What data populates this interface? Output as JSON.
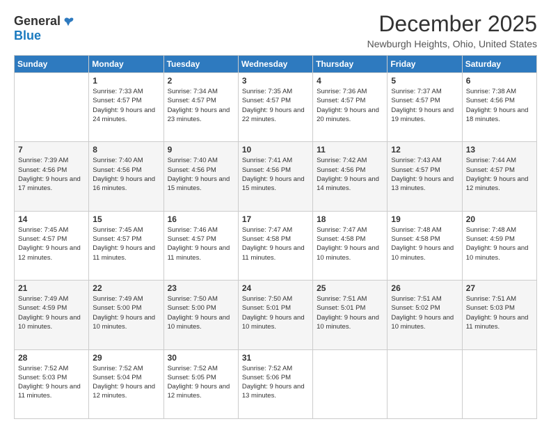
{
  "logo": {
    "general": "General",
    "blue": "Blue"
  },
  "header": {
    "month_year": "December 2025",
    "location": "Newburgh Heights, Ohio, United States"
  },
  "days_of_week": [
    "Sunday",
    "Monday",
    "Tuesday",
    "Wednesday",
    "Thursday",
    "Friday",
    "Saturday"
  ],
  "weeks": [
    [
      {
        "num": "",
        "sunrise": "",
        "sunset": "",
        "daylight": "",
        "empty": true
      },
      {
        "num": "1",
        "sunrise": "Sunrise: 7:33 AM",
        "sunset": "Sunset: 4:57 PM",
        "daylight": "Daylight: 9 hours and 24 minutes."
      },
      {
        "num": "2",
        "sunrise": "Sunrise: 7:34 AM",
        "sunset": "Sunset: 4:57 PM",
        "daylight": "Daylight: 9 hours and 23 minutes."
      },
      {
        "num": "3",
        "sunrise": "Sunrise: 7:35 AM",
        "sunset": "Sunset: 4:57 PM",
        "daylight": "Daylight: 9 hours and 22 minutes."
      },
      {
        "num": "4",
        "sunrise": "Sunrise: 7:36 AM",
        "sunset": "Sunset: 4:57 PM",
        "daylight": "Daylight: 9 hours and 20 minutes."
      },
      {
        "num": "5",
        "sunrise": "Sunrise: 7:37 AM",
        "sunset": "Sunset: 4:57 PM",
        "daylight": "Daylight: 9 hours and 19 minutes."
      },
      {
        "num": "6",
        "sunrise": "Sunrise: 7:38 AM",
        "sunset": "Sunset: 4:56 PM",
        "daylight": "Daylight: 9 hours and 18 minutes."
      }
    ],
    [
      {
        "num": "7",
        "sunrise": "Sunrise: 7:39 AM",
        "sunset": "Sunset: 4:56 PM",
        "daylight": "Daylight: 9 hours and 17 minutes."
      },
      {
        "num": "8",
        "sunrise": "Sunrise: 7:40 AM",
        "sunset": "Sunset: 4:56 PM",
        "daylight": "Daylight: 9 hours and 16 minutes."
      },
      {
        "num": "9",
        "sunrise": "Sunrise: 7:40 AM",
        "sunset": "Sunset: 4:56 PM",
        "daylight": "Daylight: 9 hours and 15 minutes."
      },
      {
        "num": "10",
        "sunrise": "Sunrise: 7:41 AM",
        "sunset": "Sunset: 4:56 PM",
        "daylight": "Daylight: 9 hours and 15 minutes."
      },
      {
        "num": "11",
        "sunrise": "Sunrise: 7:42 AM",
        "sunset": "Sunset: 4:56 PM",
        "daylight": "Daylight: 9 hours and 14 minutes."
      },
      {
        "num": "12",
        "sunrise": "Sunrise: 7:43 AM",
        "sunset": "Sunset: 4:57 PM",
        "daylight": "Daylight: 9 hours and 13 minutes."
      },
      {
        "num": "13",
        "sunrise": "Sunrise: 7:44 AM",
        "sunset": "Sunset: 4:57 PM",
        "daylight": "Daylight: 9 hours and 12 minutes."
      }
    ],
    [
      {
        "num": "14",
        "sunrise": "Sunrise: 7:45 AM",
        "sunset": "Sunset: 4:57 PM",
        "daylight": "Daylight: 9 hours and 12 minutes."
      },
      {
        "num": "15",
        "sunrise": "Sunrise: 7:45 AM",
        "sunset": "Sunset: 4:57 PM",
        "daylight": "Daylight: 9 hours and 11 minutes."
      },
      {
        "num": "16",
        "sunrise": "Sunrise: 7:46 AM",
        "sunset": "Sunset: 4:57 PM",
        "daylight": "Daylight: 9 hours and 11 minutes."
      },
      {
        "num": "17",
        "sunrise": "Sunrise: 7:47 AM",
        "sunset": "Sunset: 4:58 PM",
        "daylight": "Daylight: 9 hours and 11 minutes."
      },
      {
        "num": "18",
        "sunrise": "Sunrise: 7:47 AM",
        "sunset": "Sunset: 4:58 PM",
        "daylight": "Daylight: 9 hours and 10 minutes."
      },
      {
        "num": "19",
        "sunrise": "Sunrise: 7:48 AM",
        "sunset": "Sunset: 4:58 PM",
        "daylight": "Daylight: 9 hours and 10 minutes."
      },
      {
        "num": "20",
        "sunrise": "Sunrise: 7:48 AM",
        "sunset": "Sunset: 4:59 PM",
        "daylight": "Daylight: 9 hours and 10 minutes."
      }
    ],
    [
      {
        "num": "21",
        "sunrise": "Sunrise: 7:49 AM",
        "sunset": "Sunset: 4:59 PM",
        "daylight": "Daylight: 9 hours and 10 minutes."
      },
      {
        "num": "22",
        "sunrise": "Sunrise: 7:49 AM",
        "sunset": "Sunset: 5:00 PM",
        "daylight": "Daylight: 9 hours and 10 minutes."
      },
      {
        "num": "23",
        "sunrise": "Sunrise: 7:50 AM",
        "sunset": "Sunset: 5:00 PM",
        "daylight": "Daylight: 9 hours and 10 minutes."
      },
      {
        "num": "24",
        "sunrise": "Sunrise: 7:50 AM",
        "sunset": "Sunset: 5:01 PM",
        "daylight": "Daylight: 9 hours and 10 minutes."
      },
      {
        "num": "25",
        "sunrise": "Sunrise: 7:51 AM",
        "sunset": "Sunset: 5:01 PM",
        "daylight": "Daylight: 9 hours and 10 minutes."
      },
      {
        "num": "26",
        "sunrise": "Sunrise: 7:51 AM",
        "sunset": "Sunset: 5:02 PM",
        "daylight": "Daylight: 9 hours and 10 minutes."
      },
      {
        "num": "27",
        "sunrise": "Sunrise: 7:51 AM",
        "sunset": "Sunset: 5:03 PM",
        "daylight": "Daylight: 9 hours and 11 minutes."
      }
    ],
    [
      {
        "num": "28",
        "sunrise": "Sunrise: 7:52 AM",
        "sunset": "Sunset: 5:03 PM",
        "daylight": "Daylight: 9 hours and 11 minutes."
      },
      {
        "num": "29",
        "sunrise": "Sunrise: 7:52 AM",
        "sunset": "Sunset: 5:04 PM",
        "daylight": "Daylight: 9 hours and 12 minutes."
      },
      {
        "num": "30",
        "sunrise": "Sunrise: 7:52 AM",
        "sunset": "Sunset: 5:05 PM",
        "daylight": "Daylight: 9 hours and 12 minutes."
      },
      {
        "num": "31",
        "sunrise": "Sunrise: 7:52 AM",
        "sunset": "Sunset: 5:06 PM",
        "daylight": "Daylight: 9 hours and 13 minutes."
      },
      {
        "num": "",
        "sunrise": "",
        "sunset": "",
        "daylight": "",
        "empty": true
      },
      {
        "num": "",
        "sunrise": "",
        "sunset": "",
        "daylight": "",
        "empty": true
      },
      {
        "num": "",
        "sunrise": "",
        "sunset": "",
        "daylight": "",
        "empty": true
      }
    ]
  ]
}
